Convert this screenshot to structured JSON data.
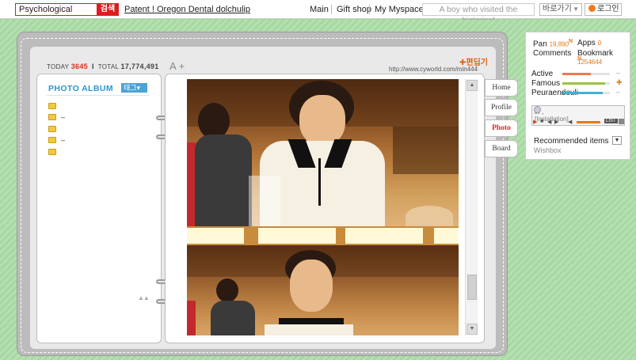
{
  "topbar": {
    "search_value": "Psychological",
    "search_button": "검색",
    "patent_link": "Patent ! Oregon Dental dolchulip",
    "nav": [
      "Main",
      "Gift shop",
      "My Myspace"
    ],
    "visit_text": "A boy who visited the historical",
    "goto_label": "바로가기",
    "goto_arrow": "▼",
    "login_label": "로그인"
  },
  "minihome": {
    "today_label": "TODAY",
    "today_count": "3645",
    "sep": "I",
    "total_label": "TOTAL",
    "total_count": "17,774,491",
    "font_size_control": "A +",
    "edit_label": "✚편딥기",
    "url": "http://www.cyworld.com/min444"
  },
  "album": {
    "title": "PHOTO ALBUM",
    "tag_button": "태그▾",
    "folders": [
      {
        "label": ""
      },
      {
        "label": "–"
      },
      {
        "label": ""
      },
      {
        "label": "–"
      },
      {
        "label": ""
      }
    ],
    "scroll_hint": "▲▲"
  },
  "tabs": [
    "Home",
    "Profile",
    "Photo",
    "Board"
  ],
  "active_tab": "Photo",
  "scrollbar": {
    "up": "▲",
    "down": "▼"
  },
  "side": {
    "pan_label": "Pan",
    "pan_value": "19,890",
    "pan_badge": "N",
    "apps_label": "Apps",
    "apps_value": "0",
    "comments_label": "Comments",
    "bookmark_label": "Bookmark",
    "bookmark_value": "1254644",
    "bookmark_badge": "N",
    "stats": [
      {
        "label": "Active",
        "level": 0.6,
        "color": "#f07a4a",
        "mark": "–"
      },
      {
        "label": "Famous",
        "level": 0.9,
        "color": "#9ac33d",
        "mark": "✚"
      },
      {
        "label": "Peuraendeuli",
        "level": 0.85,
        "color": "#3fb3d6",
        "mark": "–"
      }
    ],
    "player_line1": "in ,",
    "player_line2": "[Installation]",
    "player_list": "LIST",
    "recommended": "Recommended items",
    "recommended_btn": "▼",
    "wishbox": "Wishbox"
  },
  "colors": {
    "background_green": "#a8d8a3",
    "accent_red": "#d81e1e",
    "album_blue": "#2b95d1",
    "orange": "#e07a1e"
  }
}
